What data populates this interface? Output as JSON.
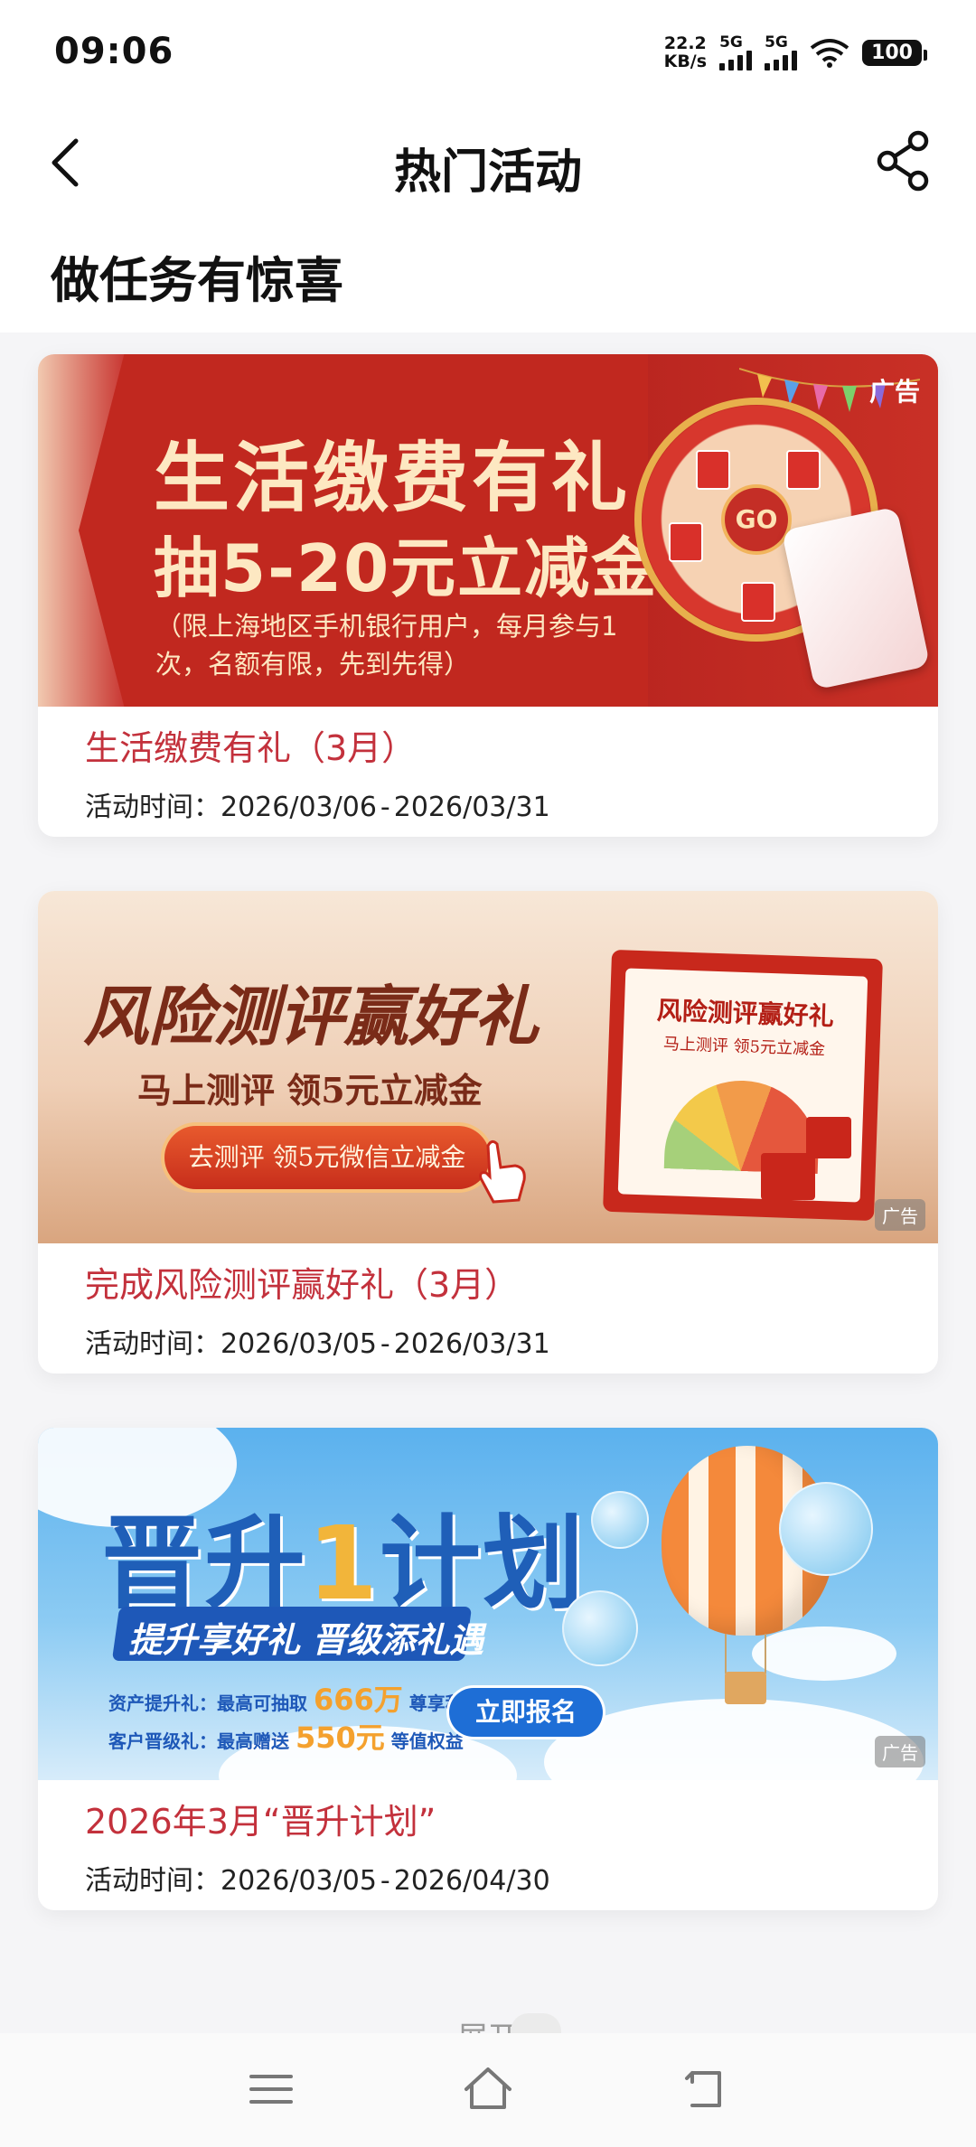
{
  "status_bar": {
    "time": "09:06",
    "net_speed_value": "22.2",
    "net_speed_unit": "KB/s",
    "sim1": "5G",
    "sim2": "5G",
    "battery": "100"
  },
  "header": {
    "title": "热门活动",
    "back_icon": "chevron-left-icon",
    "share_icon": "share-icon"
  },
  "section_title": "做任务有惊喜",
  "cards": [
    {
      "title": "生活缴费有礼（3月）",
      "time_label": "活动时间：",
      "start": "2026/03/06",
      "end": "2026/03/31",
      "banner": {
        "ad": "广告",
        "headline": "生活缴费有礼",
        "subline": "抽5-20元立减金",
        "note": "（限上海地区手机银行用户，每月参与1次，名额有限，先到先得）",
        "wheel_center": "GO"
      }
    },
    {
      "title": "完成风险测评赢好礼（3月）",
      "time_label": "活动时间：",
      "start": "2026/03/05",
      "end": "2026/03/31",
      "banner": {
        "ad": "广告",
        "headline": "风险测评赢好礼",
        "subline": "马上测评 领5元立减金",
        "button": "去测评 领5元微信立减金",
        "poster_title": "风险测评赢好礼",
        "poster_sub": "马上测评 领5元立减金"
      }
    },
    {
      "title": "2026年3月“晋升计划”",
      "time_label": "活动时间：",
      "start": "2026/03/05",
      "end": "2026/04/30",
      "banner": {
        "ad": "广告",
        "headline_a": "晋升",
        "headline_one": "1",
        "headline_b": "计划",
        "subline": "提升享好礼 晋级添礼遇",
        "line1_label": "资产提升礼：最高可抽取",
        "line1_value": "666万",
        "line1_suffix": "尊享积分",
        "line2_label": "客户晋级礼：最高赠送",
        "line2_value": "550元",
        "line2_suffix": "等值权益",
        "button": "立即报名"
      }
    }
  ],
  "footer": {
    "expand_label": "展开"
  },
  "nav_bar": {
    "menu_icon": "menu-icon",
    "home_icon": "home-icon",
    "back_icon": "back-icon"
  },
  "colors": {
    "title_red": "#c3313c",
    "banner1_red": "#b7241f",
    "banner3_blue": "#1e58b8"
  }
}
